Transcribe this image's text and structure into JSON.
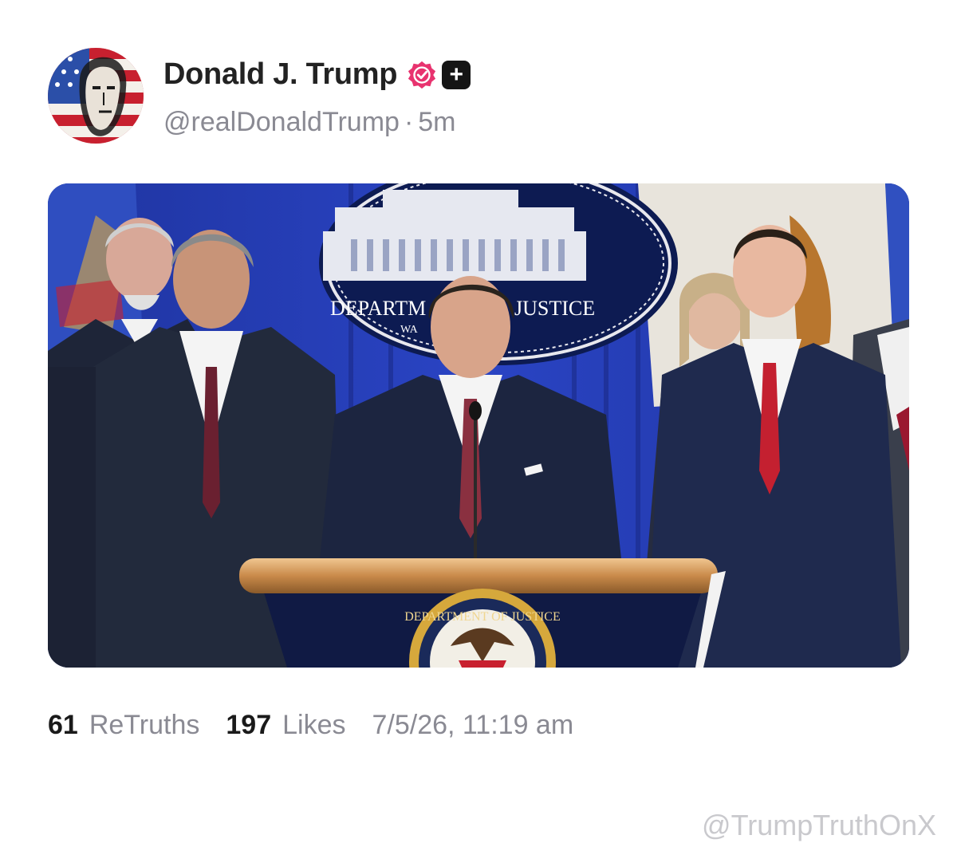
{
  "post": {
    "author": {
      "display_name": "Donald J. Trump",
      "handle": "@realDonaldTrump",
      "verified_icon": "verified-badge-icon",
      "plus_icon": "plus-icon",
      "plus_symbol": "+"
    },
    "time_separator": "·",
    "relative_time": "5m",
    "media": {
      "podium_sign": "DEPARTM",
      "podium_sign_2": "JUSTICE",
      "podium_sign_3": "WA",
      "seal_text": "DEPARTMENT OF JUSTICE"
    },
    "stats": {
      "retruths_count": "61",
      "retruths_label": "ReTruths",
      "likes_count": "197",
      "likes_label": "Likes",
      "timestamp": "7/5/26, 11:19 am"
    }
  },
  "watermark": "@TrumpTruthOnX",
  "colors": {
    "verified": "#e8336f",
    "backdrop_blue": "#2336a8",
    "name_text": "#222222",
    "muted_text": "#8a8a93"
  }
}
